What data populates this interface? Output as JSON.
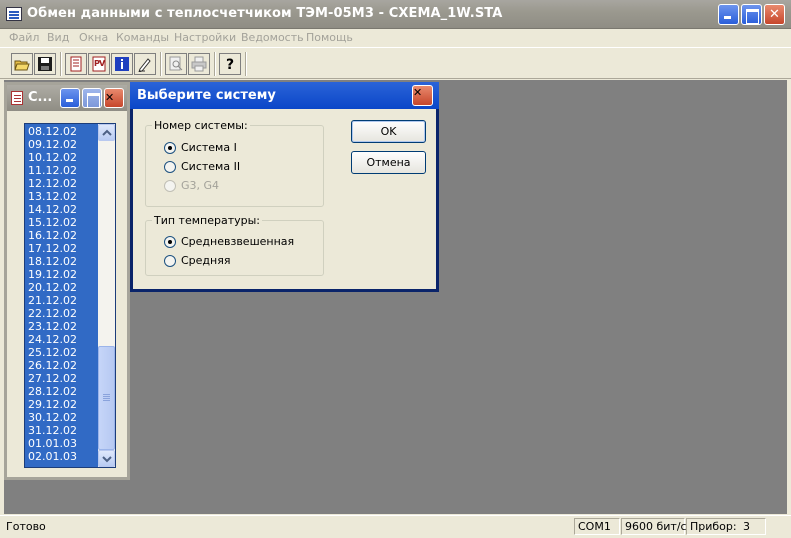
{
  "window": {
    "title": "Обмен данными с теплосчетчиком ТЭМ-05М3 - СХЕМА_1W.STA"
  },
  "menu": {
    "items": [
      "Файл",
      "Вид",
      "Окна",
      "Команды",
      "Настройки",
      "Ведомость",
      "Помощь"
    ]
  },
  "toolbar": {
    "buttons": [
      "open-icon",
      "save-icon",
      "report-icon",
      "meter-icon",
      "info-icon",
      "edit-icon",
      "print-preview-icon",
      "print-icon",
      "help-icon"
    ]
  },
  "child_window": {
    "title": "С...",
    "dates": [
      "08.12.02",
      "09.12.02",
      "10.12.02",
      "11.12.02",
      "12.12.02",
      "13.12.02",
      "14.12.02",
      "15.12.02",
      "16.12.02",
      "17.12.02",
      "18.12.02",
      "19.12.02",
      "20.12.02",
      "21.12.02",
      "22.12.02",
      "23.12.02",
      "24.12.02",
      "25.12.02",
      "26.12.02",
      "27.12.02",
      "28.12.02",
      "29.12.02",
      "30.12.02",
      "31.12.02",
      "01.01.03",
      "02.01.03"
    ]
  },
  "dialog": {
    "title": "Выберите систему",
    "system_group": {
      "label": "Номер системы:",
      "options": [
        "Система I",
        "Система II",
        "G3, G4"
      ],
      "selected": "Система I"
    },
    "temp_group": {
      "label": "Тип температуры:",
      "options": [
        "Средневзвешенная",
        "Средняя"
      ],
      "selected": "Средневзвешенная"
    },
    "ok_label": "OK",
    "cancel_label": "Отмена"
  },
  "status": {
    "text": "Готово",
    "port": "COM1",
    "speed": "9600 бит/с",
    "device_label": "Прибор:",
    "device_value": "3"
  },
  "colors": {
    "accent": "#0A246A",
    "selection": "#316AC5",
    "workspace": "#808080"
  }
}
